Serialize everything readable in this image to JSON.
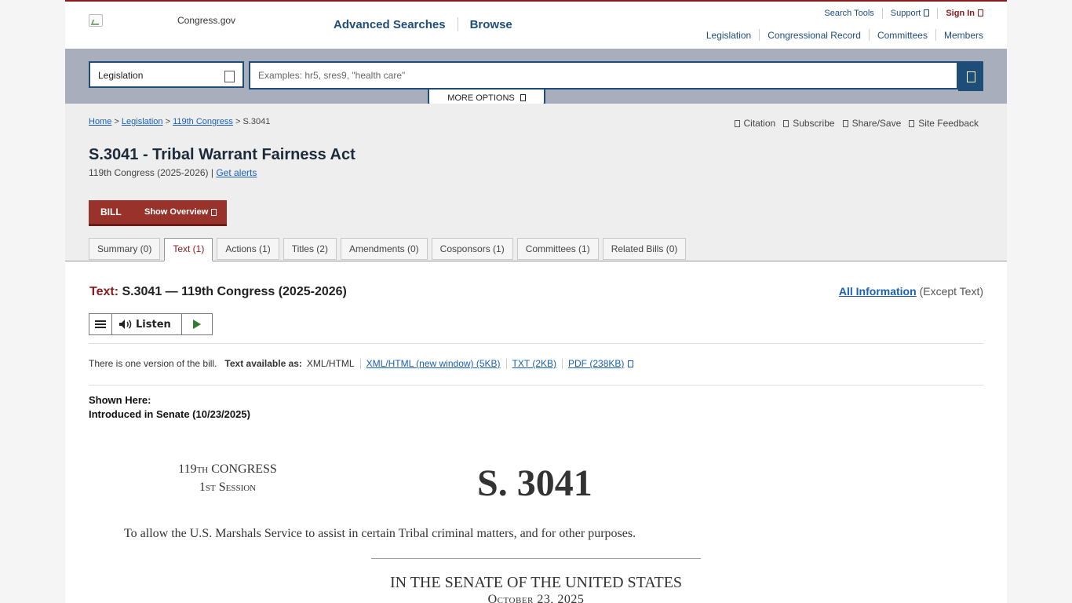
{
  "header": {
    "logo_text": "Congress.gov",
    "main_nav": [
      "Advanced Searches",
      "Browse"
    ],
    "util_nav": {
      "search_tools": "Search Tools",
      "support": "Support",
      "sign_in": "Sign In"
    },
    "site_nav": [
      "Legislation",
      "Congressional Record",
      "Committees",
      "Members"
    ]
  },
  "search": {
    "scope": "Legislation",
    "placeholder": "Examples: hr5, sres9, \"health care\"",
    "more_options": "MORE OPTIONS"
  },
  "breadcrumb": {
    "home": "Home",
    "legislation": "Legislation",
    "congress": "119th Congress",
    "current": "S.3041"
  },
  "tools": [
    "Citation",
    "Subscribe",
    "Share/Save",
    "Site Feedback"
  ],
  "bill": {
    "title": "S.3041 - Tribal Warrant Fairness Act",
    "congress_years": "119th Congress (2025-2026) |",
    "get_alerts": "Get alerts",
    "type_label": "BILL",
    "show_overview": "Show Overview"
  },
  "tabs": [
    "Summary (0)",
    "Text (1)",
    "Actions (1)",
    "Titles (2)",
    "Amendments (0)",
    "Cosponsors (1)",
    "Committees (1)",
    "Related Bills (0)"
  ],
  "active_tab": "Text (1)",
  "content": {
    "heading_label": "Text:",
    "heading_text": "S.3041 — 119th Congress (2025-2026)",
    "all_information": "All Information",
    "except_text": "(Except Text)",
    "listen": "Listen",
    "versions_note": "There is one version of the bill.",
    "available_as": "Text available as:",
    "formats": [
      "XML/HTML",
      "XML/HTML (new window) (5KB)",
      "TXT (2KB)",
      "PDF (238KB)"
    ],
    "shown_here": "Shown Here:",
    "introduced": "Introduced in Senate (10/23/2025)"
  },
  "document": {
    "congress_num": "119",
    "congress_th": "TH",
    "congress_word": "CONGRESS",
    "session_num": "1",
    "session_st": "ST",
    "session_word": "Session",
    "bill_number": "S. 3041",
    "purpose": "To allow the U.S. Marshals Service to assist in certain Tribal criminal matters, and for other purposes.",
    "chamber": "IN THE SENATE OF THE UNITED STATES",
    "date": "October 23, 2025"
  },
  "colors": {
    "brand_red": "#8b1a1a",
    "nav_blue": "#1f4d7a",
    "link_blue": "#1a5fb4",
    "bill_bar": "#98322a"
  }
}
